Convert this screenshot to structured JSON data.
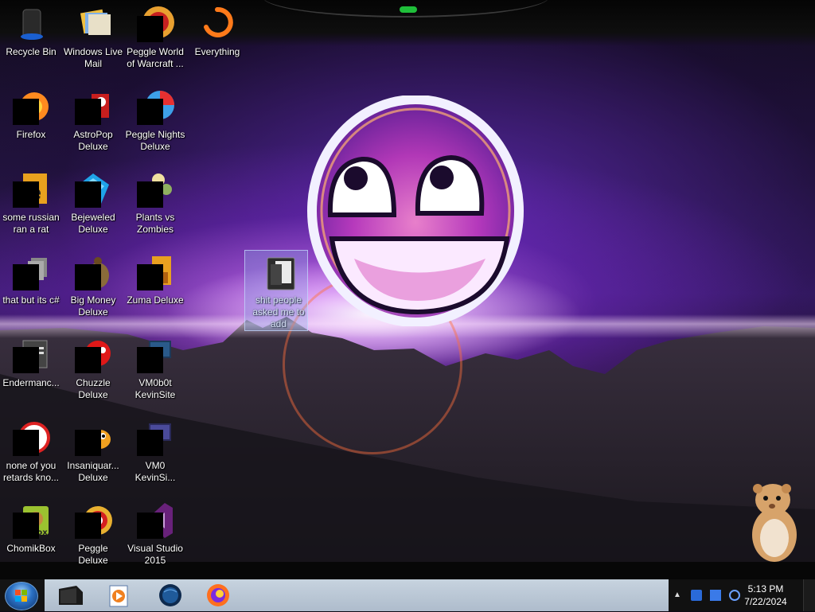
{
  "desktop": {
    "icons": [
      {
        "label": "Recycle Bin",
        "icon": "recycle-bin-icon"
      },
      {
        "label": "Windows Live Mail",
        "icon": "mail-icon"
      },
      {
        "label": "Peggle World of Warcraft ...",
        "icon": "peggle-icon"
      },
      {
        "label": "Everything",
        "icon": "search-icon"
      },
      {
        "label": "Firefox",
        "icon": "firefox-icon"
      },
      {
        "label": "AstroPop Deluxe",
        "icon": "game-icon"
      },
      {
        "label": "Peggle Nights Deluxe",
        "icon": "peggle-icon"
      },
      {
        "label": "some russian ran a rat",
        "icon": "app-icon"
      },
      {
        "label": "Bejeweled Deluxe",
        "icon": "gem-icon"
      },
      {
        "label": "Plants vs Zombies",
        "icon": "plant-icon"
      },
      {
        "label": "that but its c#",
        "icon": "shortcut-icon"
      },
      {
        "label": "Big Money Deluxe",
        "icon": "money-icon"
      },
      {
        "label": "Zuma Deluxe",
        "icon": "game-icon"
      },
      {
        "label": "Endermanc...",
        "icon": "console-icon"
      },
      {
        "label": "Chuzzle Deluxe",
        "icon": "game-icon"
      },
      {
        "label": "VM0b0t KevinSite",
        "icon": "terminal-icon"
      },
      {
        "label": "none of you retards kno...",
        "icon": "app-icon"
      },
      {
        "label": "Insaniquar... Deluxe",
        "icon": "fish-icon"
      },
      {
        "label": "VM0 KevinSi...",
        "icon": "terminal-icon"
      },
      {
        "label": "ChomikBox",
        "icon": "hamster-icon"
      },
      {
        "label": "Peggle Deluxe",
        "icon": "peggle-icon"
      },
      {
        "label": "Visual Studio 2015",
        "icon": "visual-studio-icon"
      }
    ],
    "selected_folder": {
      "label": "shit people asked me to add",
      "icon": "folder-icon"
    }
  },
  "taskbar": {
    "pinned": [
      {
        "name": "file-explorer",
        "icon": "folder-icon"
      },
      {
        "name": "media-player",
        "icon": "media-player-icon"
      },
      {
        "name": "internet",
        "icon": "globe-icon"
      },
      {
        "name": "firefox",
        "icon": "firefox-icon"
      }
    ],
    "clock": {
      "time": "5:13 PM",
      "date": "7/22/2024"
    }
  },
  "colors": {
    "taskbar_strip": "#b8c4d0",
    "wallpaper_accent": "#8a3cf0",
    "selection": "#8caae6"
  }
}
